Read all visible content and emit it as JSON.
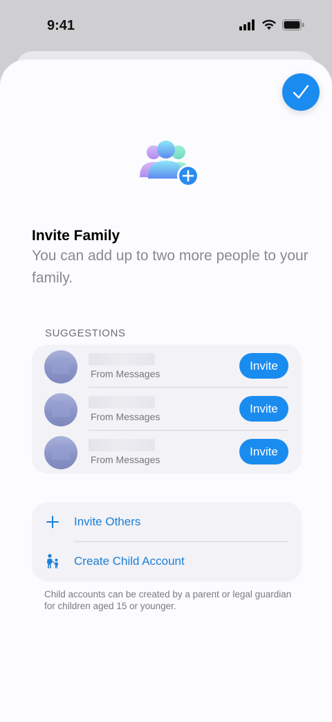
{
  "status": {
    "time": "9:41"
  },
  "header": {
    "title": "Invite Family",
    "subtitle": "You can add up to two more people to your family."
  },
  "suggestions": {
    "header": "SUGGESTIONS",
    "items": [
      {
        "source": "From Messages",
        "action": "Invite"
      },
      {
        "source": "From Messages",
        "action": "Invite"
      },
      {
        "source": "From Messages",
        "action": "Invite"
      }
    ]
  },
  "actions": {
    "invite_others": "Invite Others",
    "create_child": "Create Child Account"
  },
  "footnote": "Child accounts can be created by a parent or legal guardian for children aged 15 or younger.",
  "icons": {
    "done": "checkmark-icon",
    "hero": "family-add-icon",
    "invite_others": "plus-icon",
    "create_child": "parent-child-icon"
  },
  "colors": {
    "accent": "#1a8cf0",
    "link": "#1a7fd6"
  }
}
